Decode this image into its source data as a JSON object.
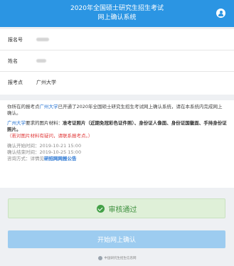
{
  "header": {
    "title_line1": "2020年全国硕士研究生招生考试",
    "title_line2": "网上确认系统"
  },
  "info": [
    {
      "label": "报名号",
      "value": ""
    },
    {
      "label": "姓名",
      "value": ""
    },
    {
      "label": "报考点",
      "value": "广州大学"
    }
  ],
  "notice": {
    "p1_a": "你所在的报考点",
    "p1_site": "广州大学",
    "p1_b": "已开通了2020年全国硕士研究生招生考试网上确认系统，请在本系统内完成网上确认。",
    "p2_site": "广州大学",
    "p2_a": "要求的图片材料：",
    "p2_materials": "准考证照片（近期免冠彩色证件照）、身份证人像面、身份证国徽面、手持身份证照片。",
    "p2_note": "（若对图片材料有疑问，请联系报考点。）",
    "start_time": "确认开始时间：2019-10-21 15:00",
    "end_time": "确认结束时间：2019-10-25 15:00",
    "consult_a": "咨询方式：详情见",
    "consult_link": "研招网网报公告"
  },
  "status": {
    "label": "审核通过",
    "color": "#3e8f3e"
  },
  "start_button": {
    "label": "开始网上确认"
  },
  "footer": {
    "text": "中国研究生招生信息网"
  },
  "colors": {
    "header": "#2b95e3",
    "link": "#1f6fd0",
    "warning": "#e03a3a",
    "success_bg": "#dff0d8",
    "button": "#9dccf0"
  }
}
